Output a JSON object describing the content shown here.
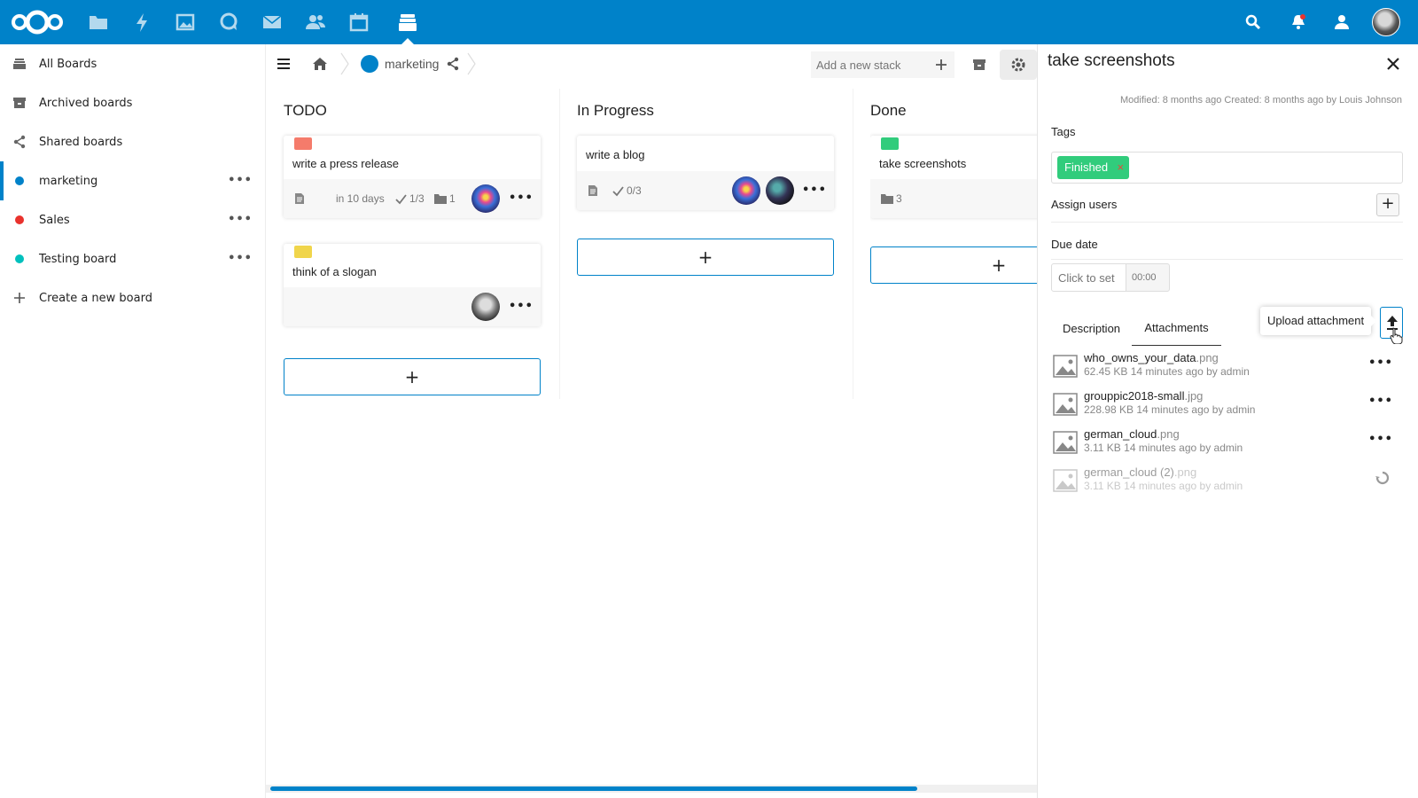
{
  "colors": {
    "primary": "#0082c9",
    "marketing": "#0082c9",
    "sales": "#e9322d",
    "testing": "#00c0bd",
    "red_label": "#f57b6b",
    "yellow_label": "#f0d54b",
    "green_label": "#31cc7c"
  },
  "topbar": {
    "apps": [
      "files-icon",
      "activity-icon",
      "photos-icon",
      "talk-icon",
      "mail-icon",
      "contacts-icon",
      "calendar-icon",
      "deck-icon"
    ],
    "active_app": "deck-icon",
    "right": [
      "search-icon",
      "notifications-icon",
      "contacts-menu-icon",
      "user-avatar"
    ]
  },
  "nav": {
    "items": [
      {
        "label": "All Boards",
        "icon": "boards-stack-icon"
      },
      {
        "label": "Archived boards",
        "icon": "archive-icon"
      },
      {
        "label": "Shared boards",
        "icon": "share-icon"
      },
      {
        "label": "marketing",
        "color": "#0082c9",
        "active": true
      },
      {
        "label": "Sales",
        "color": "#e9322d"
      },
      {
        "label": "Testing board",
        "color": "#00c0bd"
      },
      {
        "label": "Create a new board",
        "icon": "plus-icon"
      }
    ]
  },
  "board": {
    "name": "marketing",
    "add_stack_placeholder": "Add a new stack",
    "stacks": [
      {
        "title": "TODO",
        "cards": [
          {
            "title": "write a press release",
            "label_color": "#f57b6b",
            "due": "in 10 days",
            "checklist": "1/3",
            "attachments": "1"
          },
          {
            "title": "think of a slogan",
            "label_color": "#f0d54b"
          }
        ]
      },
      {
        "title": "In Progress",
        "cards": [
          {
            "title": "write a blog",
            "checklist": "0/3"
          }
        ]
      },
      {
        "title": "Done",
        "cards": [
          {
            "title": "take screenshots",
            "label_color": "#31cc7c",
            "attachments": "3"
          }
        ]
      }
    ],
    "add_card_label": "+"
  },
  "sidebar": {
    "title": "take screenshots",
    "meta": "Modified: 8 months ago Created: 8 months ago by Louis Johnson",
    "tags_label": "Tags",
    "tag": "Finished",
    "assign_label": "Assign users",
    "assign_add": "+",
    "due_label": "Due date",
    "due_placeholder": "Click to set",
    "time_placeholder": "00:00",
    "tabs": [
      "Description",
      "Attachments"
    ],
    "active_tab": "Attachments",
    "tooltip": "Upload attachment",
    "attachments": [
      {
        "name": "who_owns_your_data",
        "ext": ".png",
        "meta": "62.45 KB 14 minutes ago by admin"
      },
      {
        "name": "grouppic2018-small",
        "ext": ".jpg",
        "meta": "228.98 KB 14 minutes ago by admin"
      },
      {
        "name": "german_cloud",
        "ext": ".png",
        "meta": "3.11 KB 14 minutes ago by admin"
      },
      {
        "name": "german_cloud (2)",
        "ext": ".png",
        "meta": "3.11 KB 14 minutes ago by admin",
        "pending": true
      }
    ]
  }
}
